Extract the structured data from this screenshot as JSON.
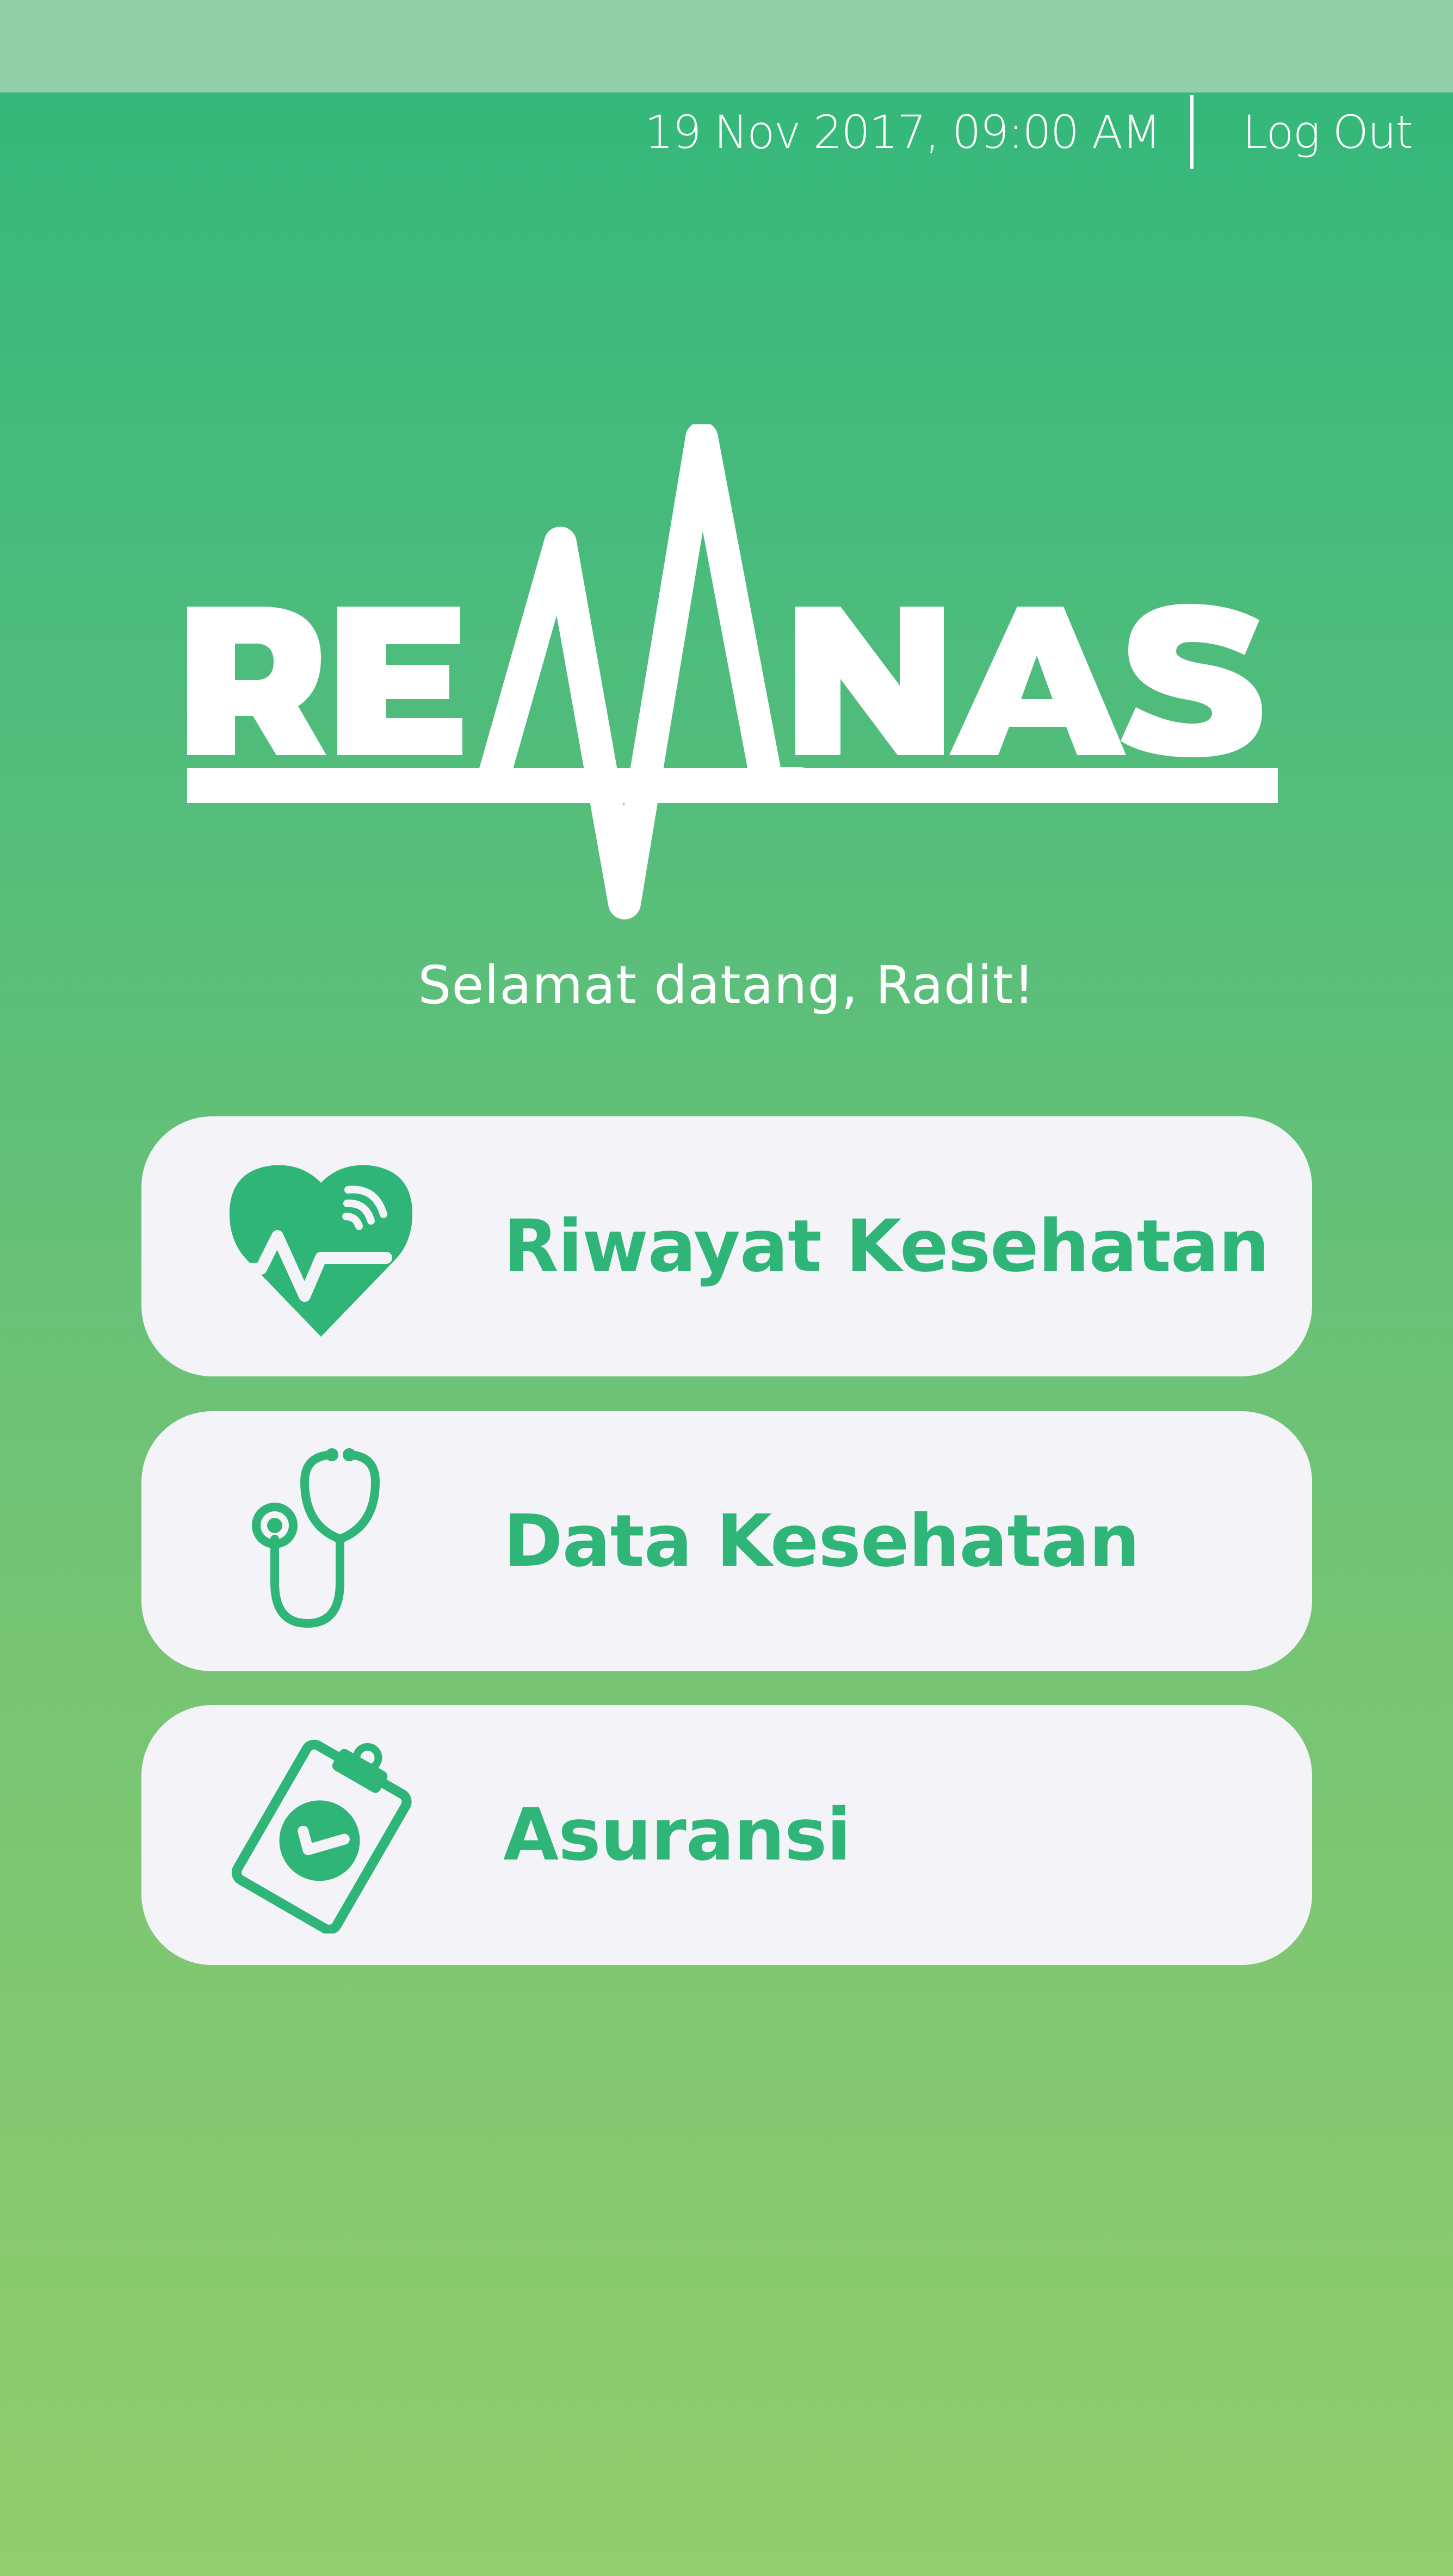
{
  "header": {
    "datetime": "19 Nov 2017, 09:00 AM",
    "logout_label": "Log Out"
  },
  "app": {
    "name": "REMNAS"
  },
  "welcome_text": "Selamat datang, Radit!",
  "menu": [
    {
      "label": "Riwayat Kesehatan",
      "icon": "heart-pulse-icon"
    },
    {
      "label": "Data Kesehatan",
      "icon": "stethoscope-icon"
    },
    {
      "label": "Asuransi",
      "icon": "clipboard-check-icon"
    }
  ],
  "colors": {
    "accent": "#2fb577",
    "card_background": "#f3f3f8",
    "status_bar": "#92d0a9",
    "gradient_top": "#31b77b",
    "gradient_bottom": "#92cc6c"
  }
}
